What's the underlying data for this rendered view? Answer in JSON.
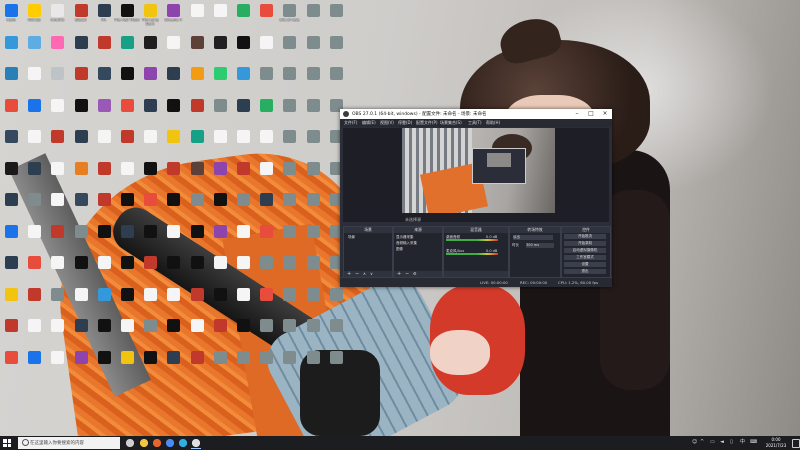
{
  "desktop": {
    "columns": 15,
    "rows": 12,
    "icons": [
      {
        "label": "Hello",
        "color": "#1a73e8"
      },
      {
        "label": "Olimbo",
        "color": "#ffcc00"
      },
      {
        "label": "Crucifix",
        "color": "#e8e8e8"
      },
      {
        "label": "Bloodl",
        "color": "#c0392b"
      },
      {
        "label": "Mr.",
        "color": "#2c3e50"
      },
      {
        "label": "The Half Moon",
        "color": "#111111"
      },
      {
        "label": "The Long Dark",
        "color": "#f1c40f"
      },
      {
        "label": "Dreams 4",
        "color": "#8e44ad"
      },
      {
        "label": "",
        "color": "#f5f5f5"
      },
      {
        "label": "",
        "color": "#f5f5f5"
      },
      {
        "label": "",
        "color": "#27ae60"
      },
      {
        "label": "",
        "color": "#e74c3c"
      },
      {
        "label": "Life of rose",
        "color": "#7f8c8d"
      },
      {
        "label": "",
        "color": "#7f8c8d"
      },
      {
        "label": "",
        "color": "#7f8c8d"
      },
      {
        "label": "",
        "color": "#3498db"
      },
      {
        "label": "",
        "color": "#5dade2"
      },
      {
        "label": "",
        "color": "#ff69b4"
      },
      {
        "label": "",
        "color": "#2c3e50"
      },
      {
        "label": "",
        "color": "#c0392b"
      },
      {
        "label": "",
        "color": "#16a085"
      },
      {
        "label": "",
        "color": "#1e1e1e"
      },
      {
        "label": "",
        "color": "#f5f5f5"
      },
      {
        "label": "",
        "color": "#5d4037"
      },
      {
        "label": "",
        "color": "#212121"
      },
      {
        "label": "",
        "color": "#111111"
      },
      {
        "label": "",
        "color": "#f5f5f5"
      },
      {
        "label": "",
        "color": "#7f8c8d"
      },
      {
        "label": "",
        "color": "#7f8c8d"
      },
      {
        "label": "",
        "color": "#7f8c8d"
      },
      {
        "label": "",
        "color": "#2980b9"
      },
      {
        "label": "",
        "color": "#f5f5f5"
      },
      {
        "label": "",
        "color": "#bdc3c7"
      },
      {
        "label": "",
        "color": "#c0392b"
      },
      {
        "label": "",
        "color": "#34495e"
      },
      {
        "label": "",
        "color": "#111111"
      },
      {
        "label": "",
        "color": "#8e44ad"
      },
      {
        "label": "",
        "color": "#2c3e50"
      },
      {
        "label": "",
        "color": "#f39c12"
      },
      {
        "label": "",
        "color": "#2ecc71"
      },
      {
        "label": "",
        "color": "#3498db"
      },
      {
        "label": "",
        "color": "#7f8c8d"
      },
      {
        "label": "",
        "color": "#7f8c8d"
      },
      {
        "label": "",
        "color": "#7f8c8d"
      },
      {
        "label": "",
        "color": "#7f8c8d"
      },
      {
        "label": "",
        "color": "#e74c3c"
      },
      {
        "label": "",
        "color": "#1a73e8"
      },
      {
        "label": "",
        "color": "#f5f5f5"
      },
      {
        "label": "",
        "color": "#111111"
      },
      {
        "label": "",
        "color": "#9b59b6"
      },
      {
        "label": "",
        "color": "#e74c3c"
      },
      {
        "label": "",
        "color": "#2c3e50"
      },
      {
        "label": "",
        "color": "#111111"
      },
      {
        "label": "",
        "color": "#c0392b"
      },
      {
        "label": "",
        "color": "#7f8c8d"
      },
      {
        "label": "",
        "color": "#2c3e50"
      },
      {
        "label": "",
        "color": "#27ae60"
      },
      {
        "label": "",
        "color": "#7f8c8d"
      },
      {
        "label": "",
        "color": "#7f8c8d"
      },
      {
        "label": "",
        "color": "#7f8c8d"
      },
      {
        "label": "",
        "color": "#34495e"
      },
      {
        "label": "",
        "color": "#f5f5f5"
      },
      {
        "label": "",
        "color": "#c0392b"
      },
      {
        "label": "",
        "color": "#2c3e50"
      },
      {
        "label": "",
        "color": "#f5f5f5"
      },
      {
        "label": "",
        "color": "#c0392b"
      },
      {
        "label": "",
        "color": "#f5f5f5"
      },
      {
        "label": "",
        "color": "#f1c40f"
      },
      {
        "label": "",
        "color": "#16a085"
      },
      {
        "label": "",
        "color": "#f5f5f5"
      },
      {
        "label": "",
        "color": "#f5f5f5"
      },
      {
        "label": "",
        "color": "#f5f5f5"
      },
      {
        "label": "",
        "color": "#7f8c8d"
      },
      {
        "label": "",
        "color": "#7f8c8d"
      },
      {
        "label": "",
        "color": "#7f8c8d"
      },
      {
        "label": "",
        "color": "#1a1a1a"
      },
      {
        "label": "",
        "color": "#2c3e50"
      },
      {
        "label": "",
        "color": "#f5f5f5"
      },
      {
        "label": "",
        "color": "#e67e22"
      },
      {
        "label": "",
        "color": "#c0392b"
      },
      {
        "label": "",
        "color": "#f5f5f5"
      },
      {
        "label": "",
        "color": "#111111"
      },
      {
        "label": "",
        "color": "#c0392b"
      },
      {
        "label": "",
        "color": "#5d4037"
      },
      {
        "label": "",
        "color": "#8e44ad"
      },
      {
        "label": "",
        "color": "#c0392b"
      },
      {
        "label": "",
        "color": "#f5f5f5"
      },
      {
        "label": "",
        "color": "#7f8c8d"
      },
      {
        "label": "",
        "color": "#7f8c8d"
      },
      {
        "label": "",
        "color": "#7f8c8d"
      },
      {
        "label": "",
        "color": "#2c3e50"
      },
      {
        "label": "",
        "color": "#7f8c8d"
      },
      {
        "label": "",
        "color": "#f5f5f5"
      },
      {
        "label": "",
        "color": "#34495e"
      },
      {
        "label": "",
        "color": "#c0392b"
      },
      {
        "label": "",
        "color": "#111111"
      },
      {
        "label": "",
        "color": "#e74c3c"
      },
      {
        "label": "",
        "color": "#111111"
      },
      {
        "label": "",
        "color": "#7f8c8d"
      },
      {
        "label": "",
        "color": "#111111"
      },
      {
        "label": "",
        "color": "#7f8c8d"
      },
      {
        "label": "",
        "color": "#2c3e50"
      },
      {
        "label": "",
        "color": "#7f8c8d"
      },
      {
        "label": "",
        "color": "#7f8c8d"
      },
      {
        "label": "",
        "color": "#7f8c8d"
      },
      {
        "label": "",
        "color": "#1a73e8"
      },
      {
        "label": "",
        "color": "#f5f5f5"
      },
      {
        "label": "",
        "color": "#c0392b"
      },
      {
        "label": "",
        "color": "#7f8c8d"
      },
      {
        "label": "",
        "color": "#111111"
      },
      {
        "label": "",
        "color": "#2c3e50"
      },
      {
        "label": "",
        "color": "#111111"
      },
      {
        "label": "",
        "color": "#f5f5f5"
      },
      {
        "label": "",
        "color": "#111111"
      },
      {
        "label": "",
        "color": "#8e44ad"
      },
      {
        "label": "",
        "color": "#f5f5f5"
      },
      {
        "label": "",
        "color": "#e74c3c"
      },
      {
        "label": "",
        "color": "#7f8c8d"
      },
      {
        "label": "",
        "color": "#7f8c8d"
      },
      {
        "label": "",
        "color": "#7f8c8d"
      },
      {
        "label": "",
        "color": "#2c3e50"
      },
      {
        "label": "",
        "color": "#e74c3c"
      },
      {
        "label": "",
        "color": "#f5f5f5"
      },
      {
        "label": "",
        "color": "#111111"
      },
      {
        "label": "",
        "color": "#f5f5f5"
      },
      {
        "label": "",
        "color": "#111111"
      },
      {
        "label": "",
        "color": "#c0392b"
      },
      {
        "label": "",
        "color": "#111111"
      },
      {
        "label": "",
        "color": "#111111"
      },
      {
        "label": "",
        "color": "#f5f5f5"
      },
      {
        "label": "",
        "color": "#f5f5f5"
      },
      {
        "label": "",
        "color": "#7f8c8d"
      },
      {
        "label": "",
        "color": "#7f8c8d"
      },
      {
        "label": "",
        "color": "#7f8c8d"
      },
      {
        "label": "",
        "color": "#7f8c8d"
      },
      {
        "label": "",
        "color": "#f1c40f"
      },
      {
        "label": "",
        "color": "#c0392b"
      },
      {
        "label": "",
        "color": "#7f8c8d"
      },
      {
        "label": "",
        "color": "#f5f5f5"
      },
      {
        "label": "",
        "color": "#3498db"
      },
      {
        "label": "",
        "color": "#111111"
      },
      {
        "label": "",
        "color": "#f5f5f5"
      },
      {
        "label": "",
        "color": "#f5f5f5"
      },
      {
        "label": "",
        "color": "#c0392b"
      },
      {
        "label": "",
        "color": "#111111"
      },
      {
        "label": "",
        "color": "#f5f5f5"
      },
      {
        "label": "",
        "color": "#e74c3c"
      },
      {
        "label": "",
        "color": "#7f8c8d"
      },
      {
        "label": "",
        "color": "#7f8c8d"
      },
      {
        "label": "",
        "color": "#7f8c8d"
      },
      {
        "label": "",
        "color": "#c0392b"
      },
      {
        "label": "",
        "color": "#f5f5f5"
      },
      {
        "label": "",
        "color": "#f5f5f5"
      },
      {
        "label": "",
        "color": "#2c3e50"
      },
      {
        "label": "",
        "color": "#111111"
      },
      {
        "label": "",
        "color": "#f5f5f5"
      },
      {
        "label": "",
        "color": "#7f8c8d"
      },
      {
        "label": "",
        "color": "#111111"
      },
      {
        "label": "",
        "color": "#f5f5f5"
      },
      {
        "label": "",
        "color": "#c0392b"
      },
      {
        "label": "",
        "color": "#111111"
      },
      {
        "label": "",
        "color": "#7f8c8d"
      },
      {
        "label": "",
        "color": "#7f8c8d"
      },
      {
        "label": "",
        "color": "#7f8c8d"
      },
      {
        "label": "",
        "color": "#7f8c8d"
      },
      {
        "label": "",
        "color": "#e74c3c"
      },
      {
        "label": "",
        "color": "#1a73e8"
      },
      {
        "label": "",
        "color": "#f5f5f5"
      },
      {
        "label": "",
        "color": "#8e44ad"
      },
      {
        "label": "",
        "color": "#111111"
      },
      {
        "label": "",
        "color": "#f1c40f"
      },
      {
        "label": "",
        "color": "#111111"
      },
      {
        "label": "",
        "color": "#2c3e50"
      },
      {
        "label": "",
        "color": "#c0392b"
      },
      {
        "label": "",
        "color": "#7f8c8d"
      },
      {
        "label": "",
        "color": "#7f8c8d"
      },
      {
        "label": "",
        "color": "#7f8c8d"
      },
      {
        "label": "",
        "color": "#7f8c8d"
      },
      {
        "label": "",
        "color": "#7f8c8d"
      },
      {
        "label": "",
        "color": "#7f8c8d"
      }
    ]
  },
  "obs": {
    "title": "OBS 27.0.1 (64-bit, windows) - 配置文件: 未命名 - 场景: 未命名",
    "menu": [
      "文件(F)",
      "编辑(E)",
      "视图(V)",
      "停靠(D)",
      "配置文件(P)",
      "场景集合(S)",
      "工具(T)",
      "帮助(H)"
    ],
    "status_label": "未选择源",
    "docks": {
      "scenes": {
        "title": "场景",
        "items": [
          "场景"
        ]
      },
      "sources": {
        "title": "来源",
        "items": [
          "显示器采集",
          "音频输入采集",
          "图像"
        ]
      },
      "mixer": {
        "title": "混音器",
        "channels": [
          {
            "name": "桌面音频",
            "db": "0.0 dB"
          },
          {
            "name": "麦克风/Aux",
            "db": "0.0 dB"
          }
        ]
      },
      "transitions": {
        "title": "转场特效",
        "type": "淡出",
        "duration_label": "时长",
        "duration": "300 ms"
      },
      "controls": {
        "title": "控件",
        "buttons": [
          "开始推流",
          "开始录制",
          "启动虚拟摄像机",
          "工作室模式",
          "设置",
          "退出"
        ]
      }
    },
    "statusbar": {
      "live": "LIVE: 00:00:00",
      "rec": "REC: 00:00:00",
      "cpu": "CPU: 1.2%, 60.00 fps"
    }
  },
  "taskbar": {
    "search_placeholder": "在这里输入你要搜索的内容",
    "time": "0:00",
    "date": "2021/7/23",
    "apps": [
      {
        "name": "task-view",
        "color": "#cfcfcf"
      },
      {
        "name": "file-explorer",
        "color": "#f4c542"
      },
      {
        "name": "firefox",
        "color": "#e8652a"
      },
      {
        "name": "chrome",
        "color": "#4c8bf5"
      },
      {
        "name": "edge",
        "color": "#2fb0e5"
      },
      {
        "name": "obs",
        "color": "#e0e0e0"
      }
    ]
  }
}
